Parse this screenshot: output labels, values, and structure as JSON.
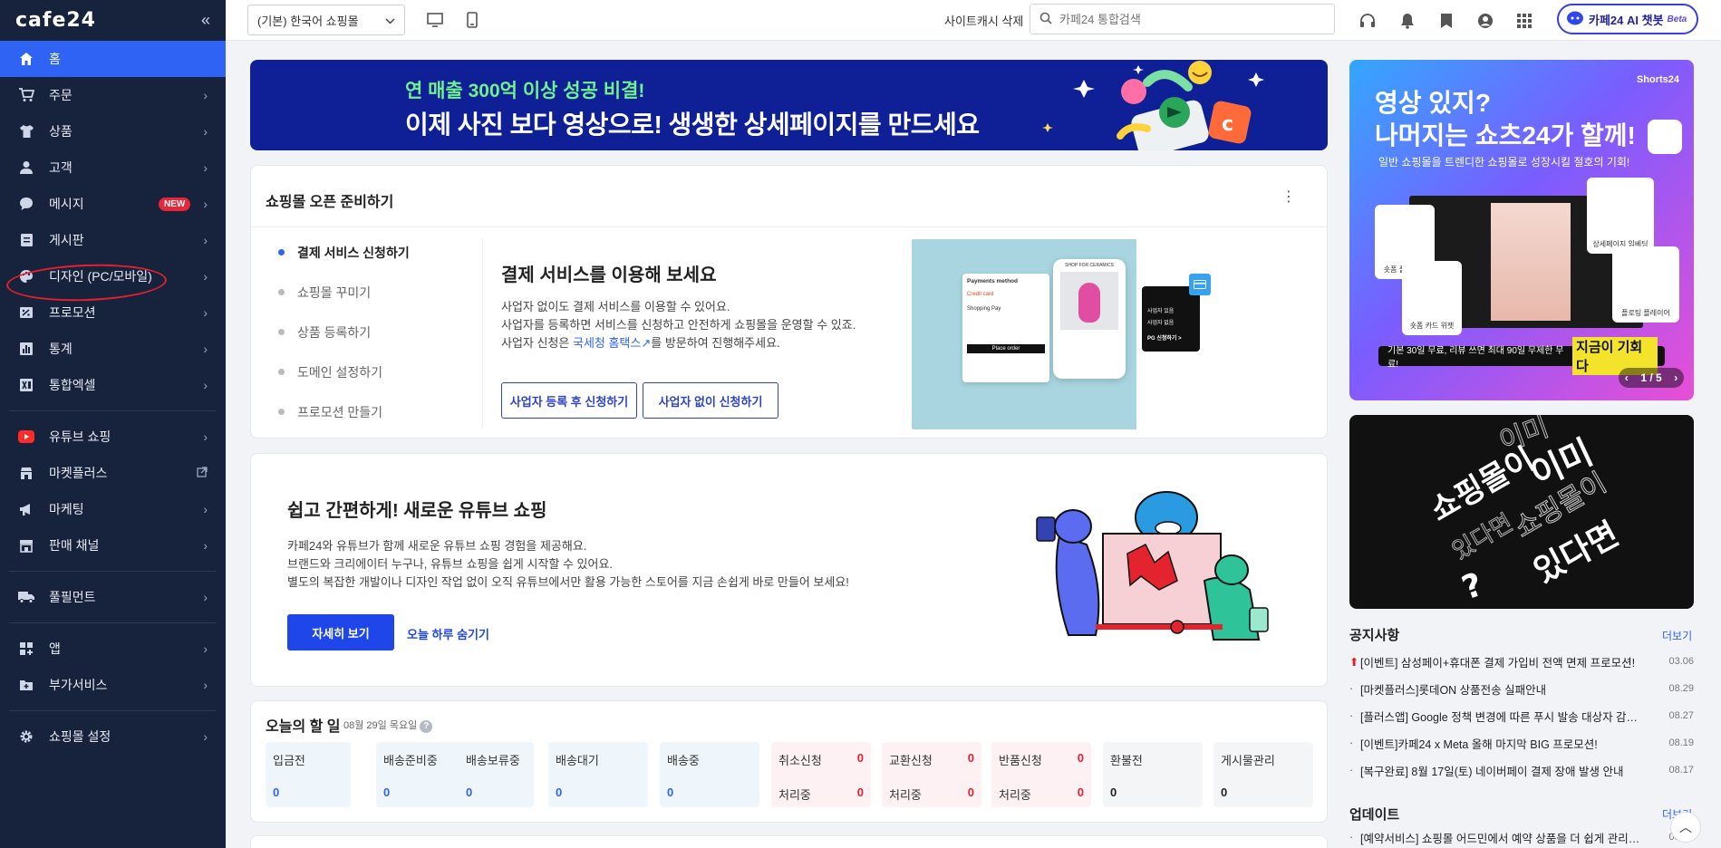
{
  "sidebar": {
    "logo": "cafe24",
    "collapse": "«",
    "items": [
      {
        "label": "홈"
      },
      {
        "label": "주문"
      },
      {
        "label": "상품"
      },
      {
        "label": "고객"
      },
      {
        "label": "메시지",
        "badge": "NEW"
      },
      {
        "label": "게시판"
      },
      {
        "label": "디자인 (PC/모바일)"
      },
      {
        "label": "프로모션"
      },
      {
        "label": "통계"
      },
      {
        "label": "통합엑셀"
      },
      {
        "label": "유튜브 쇼핑"
      },
      {
        "label": "마켓플러스"
      },
      {
        "label": "마케팅"
      },
      {
        "label": "판매 채널"
      },
      {
        "label": "풀필먼트"
      },
      {
        "label": "앱"
      },
      {
        "label": "부가서비스"
      },
      {
        "label": "쇼핑몰 설정"
      }
    ]
  },
  "topbar": {
    "mall_select": "(기본) 한국어 쇼핑몰",
    "cache_delete": "사이트캐시 삭제",
    "search_placeholder": "카페24 통합검색",
    "ai_chatbot": "카페24 AI 챗봇",
    "ai_beta": "Beta"
  },
  "banner": {
    "sub": "연 매출 300억 이상 성공 비결!",
    "main": "이제 사진 보다 영상으로! 생생한 상세페이지를 만드세요"
  },
  "prep": {
    "title": "쇼핑몰 오픈 준비하기",
    "steps": [
      "결제 서비스 신청하기",
      "쇼핑몰 꾸미기",
      "상품 등록하기",
      "도메인 설정하기",
      "프로모션 만들기"
    ],
    "heading": "결제 서비스를 이용해 보세요",
    "desc1": "사업자 없이도 결제 서비스를 이용할 수 있어요.",
    "desc2": "사업자를 등록하면 서비스를 신청하고 안전하게 쇼핑몰을 운영할 수 있죠.",
    "desc3_pre": "사업자 신청은 ",
    "desc3_link": "국세청 홈택스↗",
    "desc3_post": "를 방문하여 진행해주세요.",
    "btn1": "사업자 등록 후 신청하기",
    "btn2": "사업자 없이 신청하기",
    "illu": {
      "payments_method": "Payments method",
      "credit_card": "Credit card",
      "shopping_pay": "Shopping Pay",
      "place_order": "Place order",
      "shop_name": "SHOP FOR CERAMICS",
      "biz_yes": "사업자 있음",
      "biz_no": "사업자 없음",
      "pg_apply": "PG 신청하기 >"
    }
  },
  "youtube": {
    "title": "쉽고 간편하게! 새로운 유튜브 쇼핑",
    "desc1": "카페24와 유튜브가 함께 새로운 유튜브 쇼핑 경험을 제공해요.",
    "desc2": "브랜드와 크리에이터 누구나, 유튜브 쇼핑을 쉽게 시작할 수 있어요.",
    "desc3": "별도의 복잡한 개발이나 디자인 작업 없이 오직 유튜브에서만 활용 가능한 스토어를 지금 손쉽게 바로 만들어 보세요!",
    "detail_btn": "자세히 보기",
    "hide_today": "오늘 하루 숨기기"
  },
  "todo": {
    "title": "오늘의 할 일",
    "date": "08월 29일 목요일",
    "cells": [
      {
        "label": "입금전",
        "value": "0"
      },
      {
        "label": "배송준비중",
        "value": "0"
      },
      {
        "label": "배송보류중",
        "value": "0"
      },
      {
        "label": "배송대기",
        "value": "0"
      },
      {
        "label": "배송중",
        "value": "0"
      },
      {
        "label": "취소신청",
        "value": "0",
        "sub": "처리중",
        "sub_value": "0"
      },
      {
        "label": "교환신청",
        "value": "0",
        "sub": "처리중",
        "sub_value": "0"
      },
      {
        "label": "반품신청",
        "value": "0",
        "sub": "처리중",
        "sub_value": "0"
      },
      {
        "label": "환불전",
        "value": "0"
      },
      {
        "label": "게시물관리",
        "value": "0"
      }
    ]
  },
  "promo": {
    "brand": "Shorts24",
    "line1": "영상 있지?",
    "line2": "나머지는 쇼츠24가 할께!",
    "sub": "일반 쇼핑몰을 트렌디한 쇼핑몰로 성장시킬 절호의 기회!",
    "foot": "기본 30일 무료, 리뷰 쓰면 최대 90일 무제한 무료!",
    "foot_em": "지금이 기회다",
    "pager": "1 / 5",
    "widgets": [
      "숏폼 플레이어",
      "숏폼 카드 위젯",
      "상세페이지 임베딩",
      "플로팅 플레이어"
    ]
  },
  "dark_promo": {
    "words": [
      "이미",
      "쇼핑몰이",
      "이미",
      "쇼핑몰이",
      "있다면",
      "있다면",
      "?"
    ]
  },
  "notices": {
    "title": "공지사항",
    "more": "더보기",
    "items": [
      {
        "text": "[이벤트] 삼성페이+휴대폰 결제 가입비 전액 면제 프로모션!",
        "date": "03.06",
        "pinned": true
      },
      {
        "text": "[마켓플러스]롯데ON 상품전송 실패안내",
        "date": "08.29"
      },
      {
        "text": "[플러스앱] Google 정책 변경에 따른 푸시 발송 대상자 감…",
        "date": "08.27"
      },
      {
        "text": "[이벤트]카페24 x Meta 올해 마지막 BIG 프로모션!",
        "date": "08.19"
      },
      {
        "text": "[복구완료] 8월 17일(토) 네이버페이 결제 장애 발생 안내",
        "date": "08.17"
      }
    ]
  },
  "updates": {
    "title": "업데이트",
    "more": "더보기",
    "items": [
      {
        "text": "[예약서비스] 쇼핑몰 어드민에서 예약 상품을 더 쉽게 관리…",
        "date": "08.28"
      }
    ]
  }
}
